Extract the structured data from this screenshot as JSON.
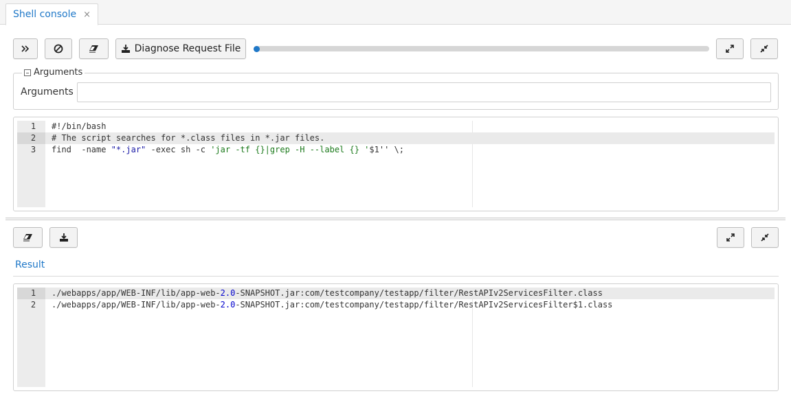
{
  "tab": {
    "label": "Shell console",
    "close": "×"
  },
  "toolbar": {
    "diagnose_label": "Diagnose Request File",
    "progress_percent": 0
  },
  "arguments": {
    "legend": "Arguments",
    "label": "Arguments",
    "value": "",
    "placeholder": ""
  },
  "script_editor": {
    "lines": [
      {
        "num": "1",
        "text": "#!/bin/bash"
      },
      {
        "num": "2",
        "text": "# The script searches for *.class files in *.jar files."
      },
      {
        "num": "3",
        "text": "find  -name \"*.jar\" -exec sh -c 'jar -tf {}|grep -H --label {} '$1'' \\;"
      }
    ],
    "active_line": 2
  },
  "result": {
    "tab_label": "Result",
    "lines": [
      {
        "num": "1",
        "text": "./webapps/app/WEB-INF/lib/app-web-2.0-SNAPSHOT.jar:com/testcompany/testapp/filter/RestAPIv2ServicesFilter.class"
      },
      {
        "num": "2",
        "text": "./webapps/app/WEB-INF/lib/app-web-2.0-SNAPSHOT.jar:com/testcompany/testapp/filter/RestAPIv2ServicesFilter$1.class"
      }
    ],
    "active_line": 1
  },
  "icons": {
    "run": "double-chevron-right-icon",
    "stop": "stop-circle-icon",
    "clear": "eraser-icon",
    "download": "download-icon",
    "maximize": "expand-arrows-icon",
    "minimize": "collapse-arrows-icon"
  },
  "colors": {
    "accent": "#1f78c8",
    "progress_track": "#d6d6d6"
  }
}
